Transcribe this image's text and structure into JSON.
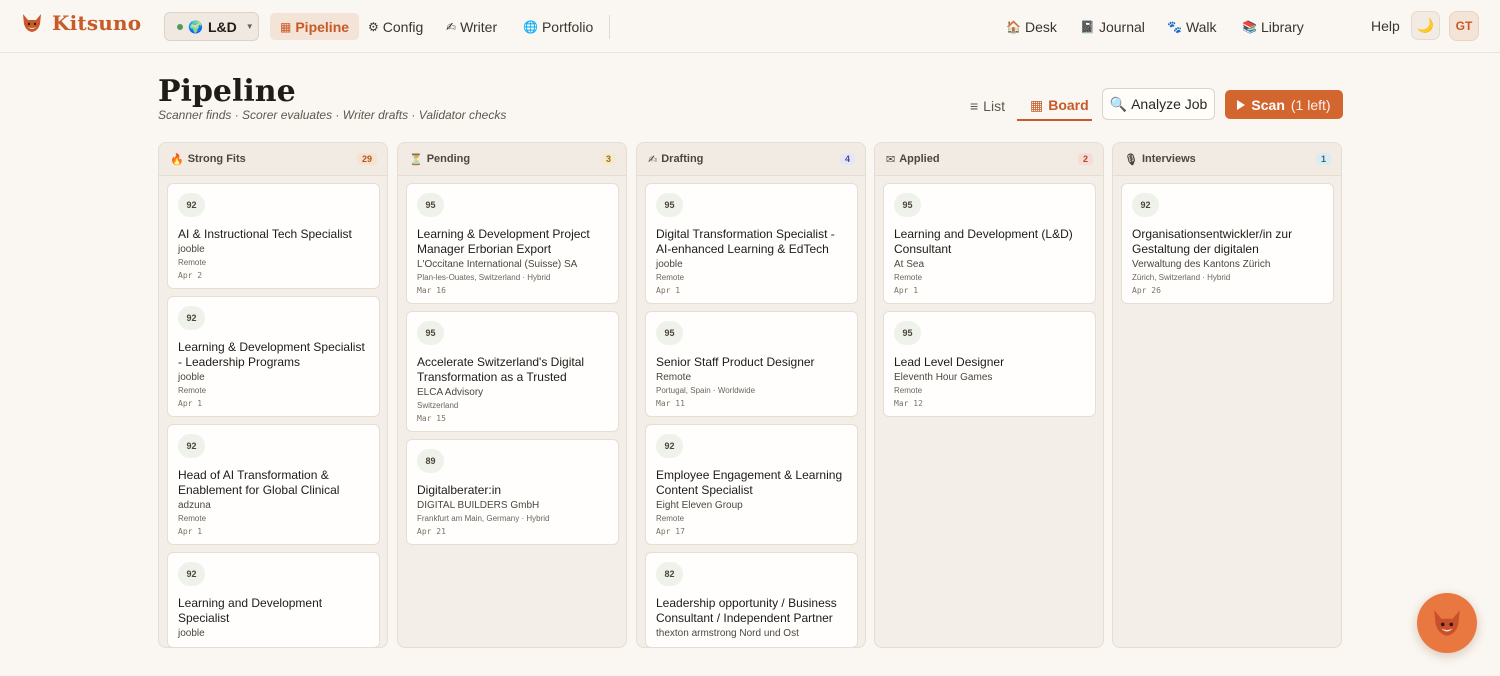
{
  "brand": {
    "name": "Kitsuno",
    "logo_icon": "fox-logo-icon"
  },
  "workspace": {
    "label": "L&D",
    "globe_icon": "🌍",
    "status_color": "#4f9a5a"
  },
  "nav": {
    "pipeline": {
      "icon": "▦",
      "label": "Pipeline"
    },
    "config": {
      "icon": "⚙",
      "label": "Config"
    },
    "writer": {
      "icon": "✍",
      "label": "Writer"
    },
    "portfolio": {
      "icon": "🌐",
      "label": "Portfolio"
    },
    "desk": {
      "icon": "🏠",
      "label": "Desk"
    },
    "journal": {
      "icon": "📓",
      "label": "Journal"
    },
    "walk": {
      "icon": "🐾",
      "label": "Walk"
    },
    "library": {
      "icon": "📚",
      "label": "Library"
    },
    "help": "Help",
    "theme_icon": "🌙",
    "avatar_initials": "GT"
  },
  "page": {
    "title": "Pipeline",
    "subtitle": "Scanner finds · Scorer evaluates · Writer drafts · Validator checks"
  },
  "view_tabs": {
    "list": {
      "icon": "≡",
      "label": "List"
    },
    "board": {
      "icon": "▦",
      "label": "Board"
    }
  },
  "actions": {
    "analyze": {
      "icon": "🔍",
      "label": "Analyze Job"
    },
    "scan": {
      "label": "Scan",
      "sub": "(1 left)"
    }
  },
  "colors": {
    "accent": "#c75a27",
    "scan_button": "#d3652f",
    "strong_badge_bg": "#f6e3cf",
    "strong_badge_fg": "#b3541f",
    "pending_badge_bg": "#f5ead0",
    "pending_badge_fg": "#9a6b10",
    "drafting_badge_bg": "#e6e6f7",
    "drafting_badge_fg": "#4a4aa0",
    "applied_badge_bg": "#f6dcd5",
    "applied_badge_fg": "#b0452a",
    "interviews_badge_bg": "#dcebf0",
    "interviews_badge_fg": "#2f6b80"
  },
  "columns": {
    "strong": {
      "icon": "🔥",
      "title": "Strong Fits",
      "count": "29",
      "cards": [
        {
          "score": "92",
          "title": "AI & Instructional Tech Specialist",
          "company": "jooble",
          "location": "Remote",
          "date": "Apr 2"
        },
        {
          "score": "92",
          "title": "Learning & Development Specialist - Leadership Programs",
          "company": "jooble",
          "location": "Remote",
          "date": "Apr 1"
        },
        {
          "score": "92",
          "title": "Head of AI Transformation & Enablement for Global Clinical",
          "company": "adzuna",
          "location": "Remote",
          "date": "Apr 1"
        },
        {
          "score": "92",
          "title": "Learning and Development Specialist",
          "company": "jooble",
          "location": "",
          "date": ""
        }
      ]
    },
    "pending": {
      "icon": "⏳",
      "title": "Pending",
      "count": "3",
      "cards": [
        {
          "score": "95",
          "title": "Learning & Development Project Manager Erborian Export",
          "company": "L'Occitane International (Suisse) SA",
          "location": "Plan-les-Ouates, Switzerland · Hybrid",
          "date": "Mar 16"
        },
        {
          "score": "95",
          "title": "Accelerate Switzerland's Digital Transformation as a Trusted",
          "company": "ELCA Advisory",
          "location": "Switzerland",
          "date": "Mar 15"
        },
        {
          "score": "89",
          "title": "Digitalberater:in",
          "company": "DIGITAL BUILDERS GmbH",
          "location": "Frankfurt am Main, Germany · Hybrid",
          "date": "Apr 21"
        }
      ]
    },
    "drafting": {
      "icon": "✍",
      "title": "Drafting",
      "count": "4",
      "cards": [
        {
          "score": "95",
          "title": "Digital Transformation Specialist - AI-enhanced Learning & EdTech",
          "company": "jooble",
          "location": "Remote",
          "date": "Apr 1"
        },
        {
          "score": "95",
          "title": "Senior Staff Product Designer",
          "company": "Remote",
          "location": "Portugal, Spain · Worldwide",
          "date": "Mar 11"
        },
        {
          "score": "92",
          "title": "Employee Engagement & Learning Content Specialist",
          "company": "Eight Eleven Group",
          "location": "Remote",
          "date": "Apr 17"
        },
        {
          "score": "82",
          "title": "Leadership opportunity / Business Consultant / Independent Partner",
          "company": "thexton armstrong Nord und Ost",
          "location": "",
          "date": ""
        }
      ]
    },
    "applied": {
      "icon": "✉",
      "title": "Applied",
      "count": "2",
      "cards": [
        {
          "score": "95",
          "title": "Learning and Development (L&D) Consultant",
          "company": "At Sea",
          "location": "Remote",
          "date": "Apr 1"
        },
        {
          "score": "95",
          "title": "Lead Level Designer",
          "company": "Eleventh Hour Games",
          "location": "Remote",
          "date": "Mar 12"
        }
      ]
    },
    "interviews": {
      "icon": "🎙",
      "title": "Interviews",
      "count": "1",
      "cards": [
        {
          "score": "92",
          "title": "Organisationsentwickler/in zur Gestaltung der digitalen",
          "company": "Verwaltung des Kantons Zürich",
          "location": "Zürich, Switzerland · Hybrid",
          "date": "Apr 26"
        }
      ]
    }
  },
  "mascot_icon": "fox-mascot-icon"
}
